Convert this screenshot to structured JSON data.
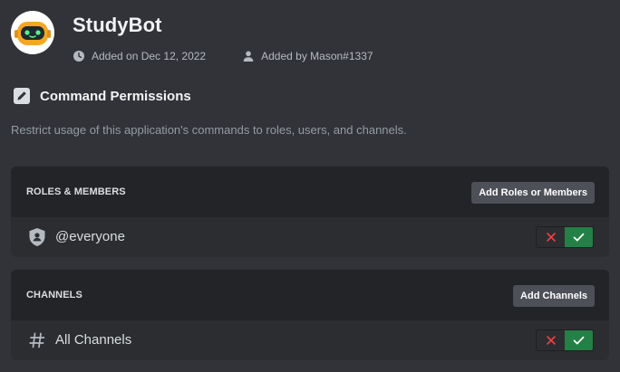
{
  "app": {
    "name": "StudyBot",
    "added_on": "Added on Dec 12, 2022",
    "added_by": "Added by Mason#1337",
    "avatar_colors": {
      "body": "#f5a623",
      "face": "#1e2a2f",
      "eyes": "#57f287"
    }
  },
  "permissions": {
    "title": "Command Permissions",
    "description": "Restrict usage of this application's commands to roles, users, and channels."
  },
  "roles_panel": {
    "header": "ROLES & MEMBERS",
    "button_label": "Add Roles or Members",
    "rows": [
      {
        "icon": "shield-person-icon",
        "label": "@everyone",
        "state": "allowed"
      }
    ]
  },
  "channels_panel": {
    "header": "CHANNELS",
    "button_label": "Add Channels",
    "rows": [
      {
        "icon": "hash-icon",
        "label": "All Channels",
        "state": "allowed"
      }
    ]
  },
  "colors": {
    "background": "#313338",
    "panel": "#2b2d31",
    "panel_header": "#232428",
    "button": "#4e5058",
    "allow_green": "#248046",
    "deny_red": "#f23f43"
  }
}
